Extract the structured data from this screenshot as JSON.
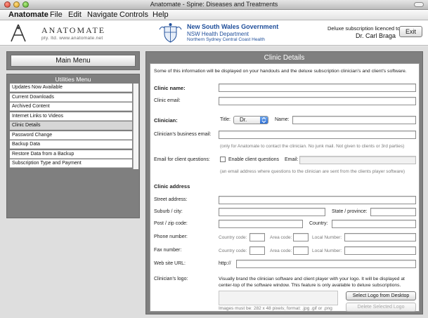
{
  "window": {
    "title": "Anatomate - Spine: Diseases and Treatments"
  },
  "menubar": {
    "items": [
      "Anatomate",
      "Edit",
      "Navigate",
      "Controls",
      "Help"
    ],
    "file": "File"
  },
  "header": {
    "brand": "ANATOMATE",
    "brand_sub": "pty. ltd.   www.anatomate.net",
    "gov_title": "New South Wales Government",
    "gov_dept": "NSW Health Department",
    "gov_area": "Northern Sydney Central Coast Health",
    "license_label": "Deluxe subscription licenced to:",
    "license_name": "Dr. Carl Braga",
    "exit_label": "Exit"
  },
  "sidebar": {
    "main_menu_label": "Main Menu",
    "utilities_title": "Utilities Menu",
    "items": [
      {
        "label": "Updates Now Available",
        "selected": false
      },
      {
        "label": "Current Downloads",
        "selected": false
      },
      {
        "label": "Archived Content",
        "selected": false
      },
      {
        "label": "Internet Links to Videos",
        "selected": false
      },
      {
        "label": "Clinic Details",
        "selected": true
      },
      {
        "label": "Password Change",
        "selected": false
      },
      {
        "label": "Backup Data",
        "selected": false
      },
      {
        "label": "Restore Data from a Backup",
        "selected": false
      },
      {
        "label": "Subscription Type and Payment",
        "selected": false
      }
    ]
  },
  "clinic": {
    "title": "Clinic Details",
    "intro": "Some of this information will be displayed on your handouts and the deluxe subscription clinician's and client's software.",
    "clinic_name_label": "Clinic name:",
    "clinic_email_label": "Clinic email:",
    "clinician_label": "Clinician:",
    "title_label": "Title:",
    "title_value": "Dr.",
    "name_label": "Name:",
    "business_email_label": "Clinician's business email:",
    "business_email_note": "(only for Anatomate to contact the clinician.  No junk mail.  Not given to clients or 3rd parties)",
    "questions_label": "Email for client questions:",
    "enable_label": "Enable client questions",
    "email_label": "Email:",
    "questions_note": "(an email address where questions to the clinician are sent from the clients player software)",
    "address_header": "Clinic address",
    "street_label": "Street address:",
    "suburb_label": "Suburb / city:",
    "state_label": "State / province:",
    "post_label": "Post / zip code:",
    "country_label": "Country:",
    "phone_label": "Phone number:",
    "fax_label": "Fax number:",
    "country_code_label": "Country code:",
    "area_code_label": "Area code:",
    "local_number_label": "Local Number:",
    "website_label": "Web site URL:",
    "website_prefix": "http://",
    "logo_label": "Clinician's logo:",
    "logo_desc_1": "Visually brand the clinician software and client player with your logo.  It will be displayed at",
    "logo_desc_2": "center-top of the software window.  This feature is only available to deluxe subscriptions.",
    "select_logo_label": "Select Logo from Desktop",
    "delete_logo_label": "Delete Selected Logo",
    "image_note": "Images must be:  282 x 48 pixels; format: .jpg .gif or .png"
  }
}
